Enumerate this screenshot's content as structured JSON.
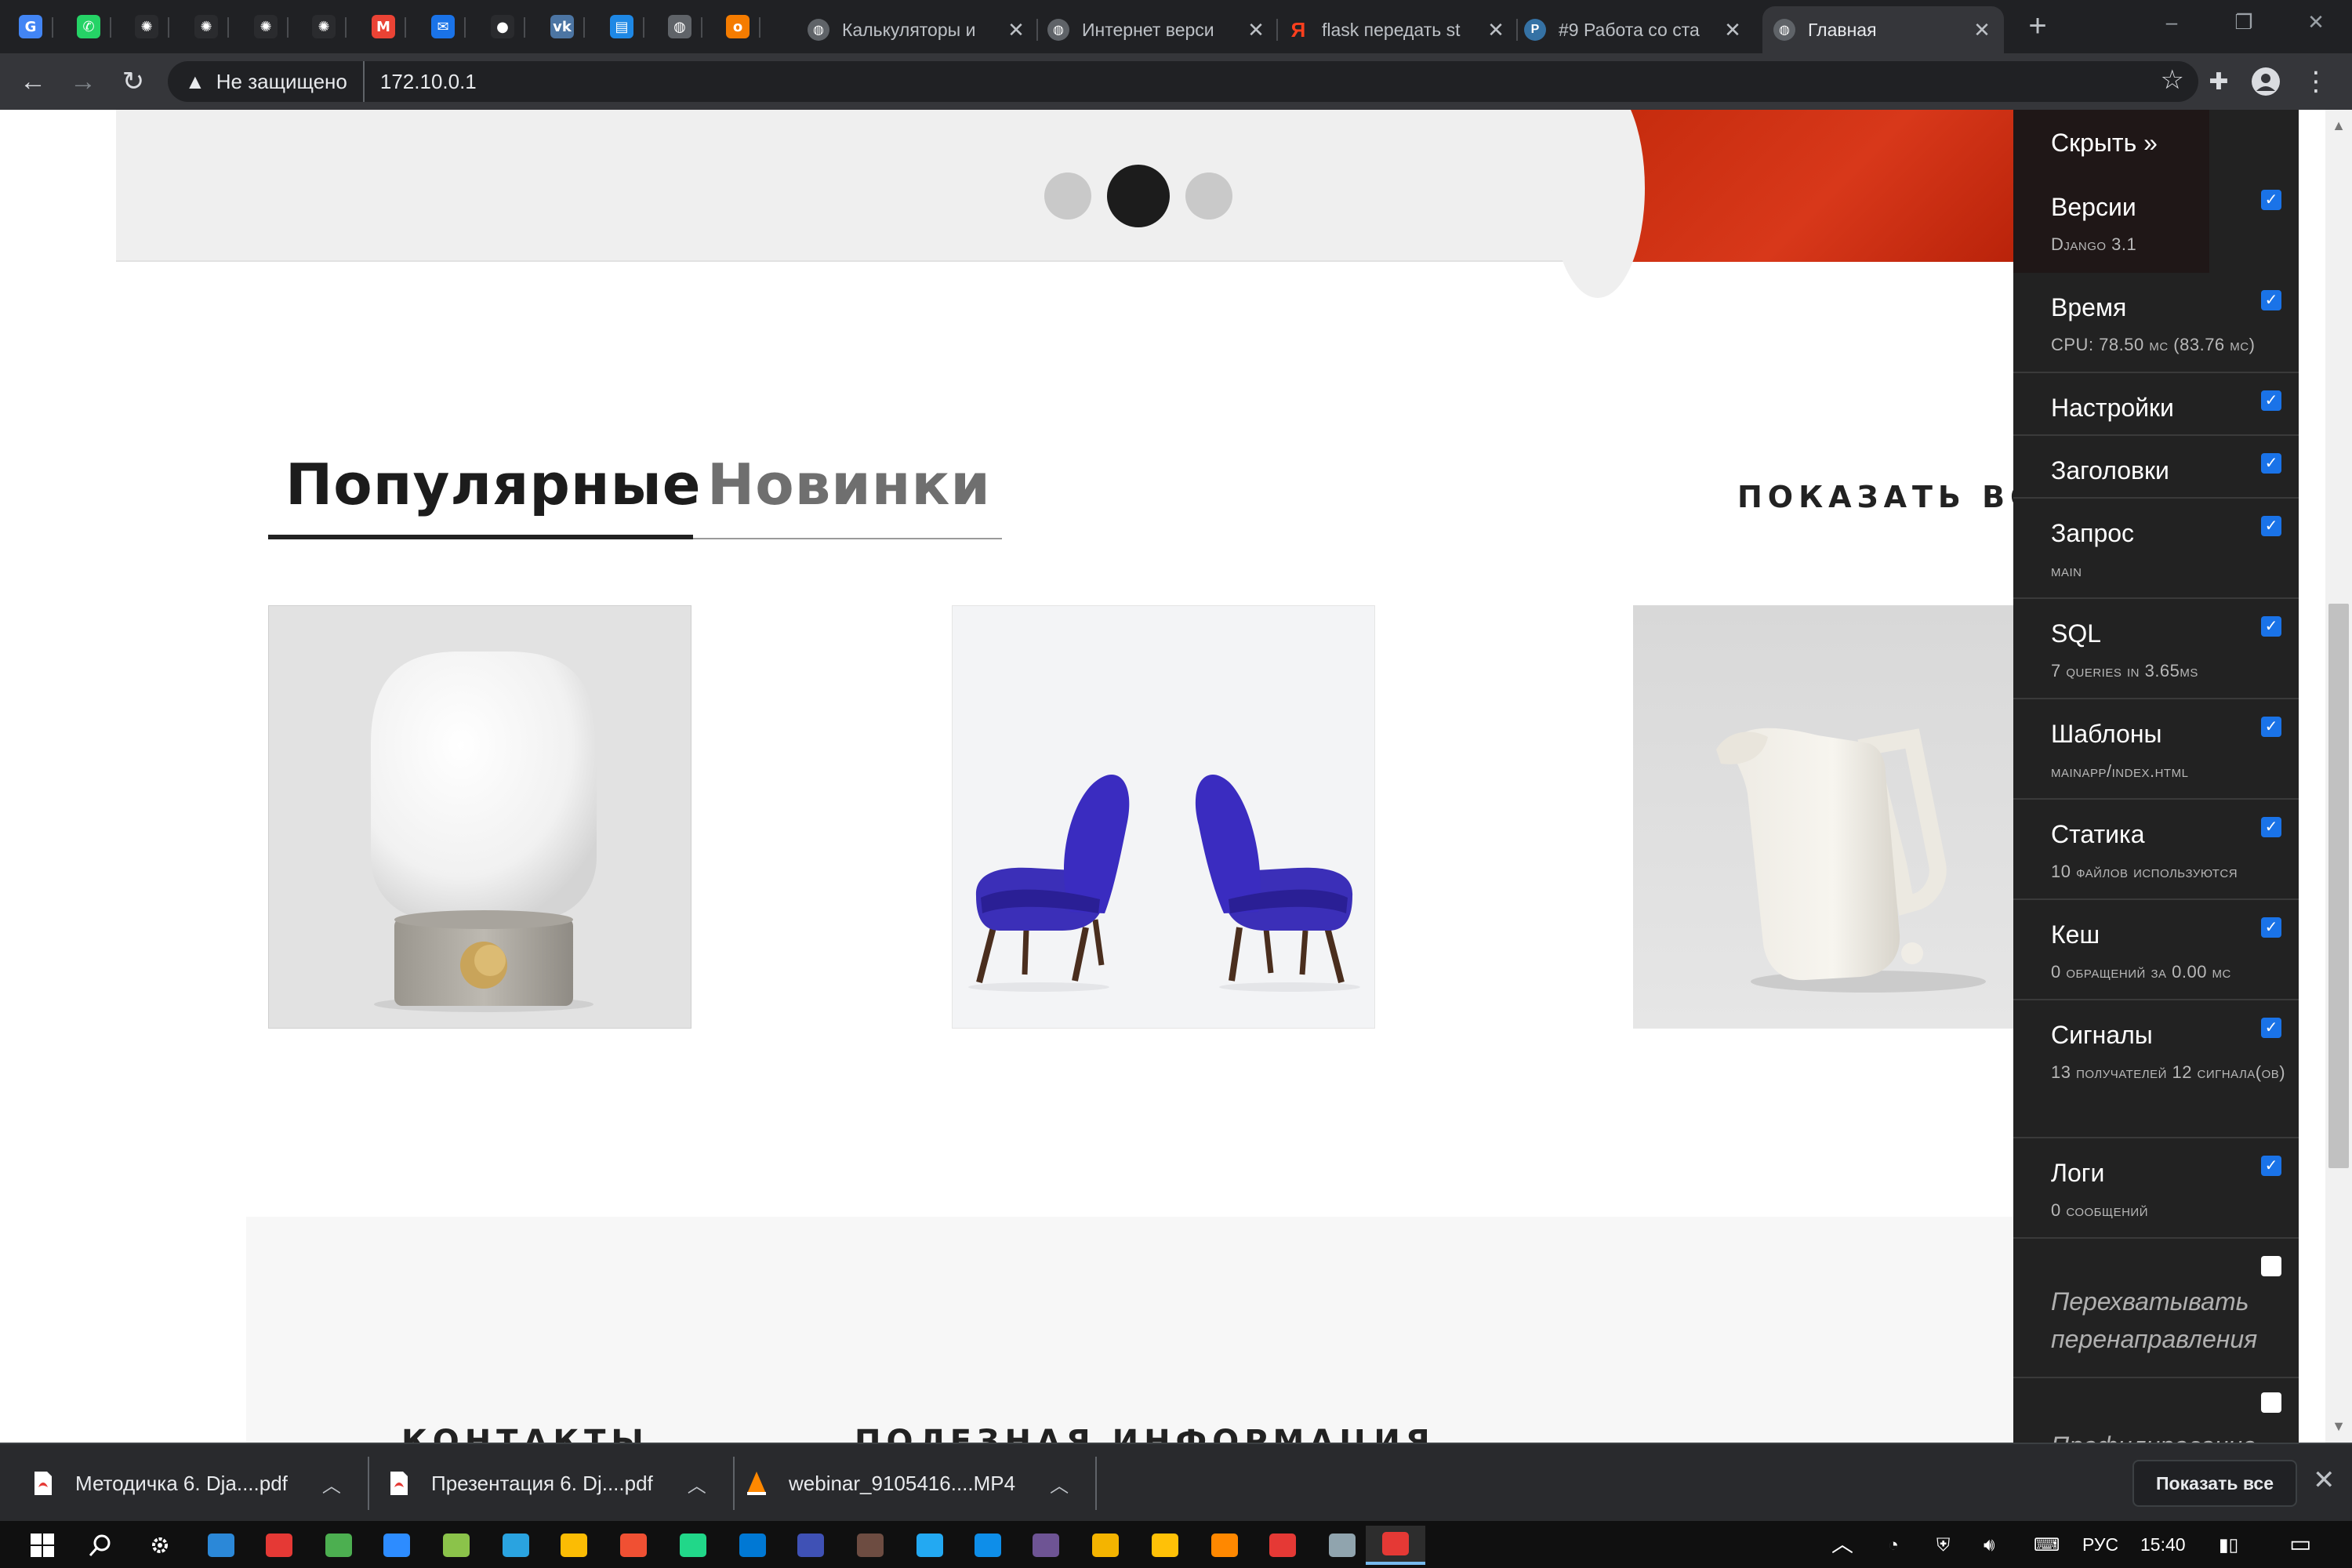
{
  "browser": {
    "pinned_tabs": [
      {
        "name": "google-translate",
        "color": "#4285f4",
        "glyph": "G"
      },
      {
        "name": "whatsapp",
        "color": "#25d366",
        "glyph": "✆"
      },
      {
        "name": "openai-1",
        "color": "#2a2b2e",
        "glyph": "✺"
      },
      {
        "name": "openai-2",
        "color": "#2a2b2e",
        "glyph": "✺"
      },
      {
        "name": "openai-3",
        "color": "#2a2b2e",
        "glyph": "✺"
      },
      {
        "name": "openai-4",
        "color": "#2a2b2e",
        "glyph": "✺"
      },
      {
        "name": "gmail",
        "color": "#ea4335",
        "glyph": "M"
      },
      {
        "name": "mail",
        "color": "#1a73e8",
        "glyph": "✉"
      },
      {
        "name": "github",
        "color": "#2a2b2e",
        "glyph": "●"
      },
      {
        "name": "vk",
        "color": "#4c75a3",
        "glyph": "vk"
      },
      {
        "name": "translate-app",
        "color": "#1e88e5",
        "glyph": "▤"
      },
      {
        "name": "globe",
        "color": "#5f6368",
        "glyph": "◍"
      },
      {
        "name": "ok",
        "color": "#f57c00",
        "glyph": "o"
      }
    ],
    "tabs": [
      {
        "title": "Калькуляторы и",
        "favicon": "globe-icon"
      },
      {
        "title": "Интернет верси",
        "favicon": "globe-icon"
      },
      {
        "title": "flask передать st",
        "favicon": "yandex-icon"
      },
      {
        "title": "#9 Работа со ста",
        "favicon": "python-icon"
      },
      {
        "title": "Главная",
        "favicon": "globe-icon"
      }
    ],
    "new_tab": "+",
    "security_label": "Не защищено",
    "url": "172.10.0.1"
  },
  "page": {
    "tabs": [
      {
        "label": "Популярные",
        "active": true
      },
      {
        "label": "Новинки",
        "active": false
      }
    ],
    "show_all": "ПОКАЗАТЬ ВСЕ",
    "show_all_arrow": "›",
    "carousel_dots": 3,
    "carousel_active_index": 1,
    "products": [
      {
        "name": "lamp-image"
      },
      {
        "name": "chairs-image"
      },
      {
        "name": "jug-image"
      }
    ],
    "footer_headings": [
      "КОНТАКТЫ",
      "ПОЛЕЗНАЯ ИНФОРМАЦИЯ"
    ]
  },
  "debug_toolbar": {
    "hide": "Скрыть »",
    "panels": [
      {
        "title": "Версии",
        "sub": "Django 3.1",
        "checked": true
      },
      {
        "title": "Время",
        "sub": "CPU: 78.50 мс (83.76 мс)",
        "checked": true
      },
      {
        "title": "Настройки",
        "sub": "",
        "checked": true
      },
      {
        "title": "Заголовки",
        "sub": "",
        "checked": true
      },
      {
        "title": "Запрос",
        "sub": "main",
        "checked": true
      },
      {
        "title": "SQL",
        "sub": "7 queries in 3.65ms",
        "checked": true
      },
      {
        "title": "Шаблоны",
        "sub": "mainapp/index.html",
        "checked": true
      },
      {
        "title": "Статика",
        "sub": "10 файлов используются",
        "checked": true
      },
      {
        "title": "Кеш",
        "sub": "0 обращений за 0.00 мс",
        "checked": true
      },
      {
        "title": "Сигналы",
        "sub": "13 получателей 12 сигнала(ов)",
        "checked": true
      },
      {
        "title": "Логи",
        "sub": "0 сообщений",
        "checked": true
      }
    ],
    "intercept_redirects": "Перехватывать перенаправления",
    "profiling": "Профилирование"
  },
  "downloads": [
    {
      "name": "Методичка 6. Dja....pdf",
      "type": "pdf-icon"
    },
    {
      "name": "Презентация 6. Dj....pdf",
      "type": "pdf-icon"
    },
    {
      "name": "webinar_9105416....MP4",
      "type": "vlc-icon"
    }
  ],
  "downloads_show_all": "Показать все",
  "taskbar": {
    "language": "РУС",
    "time": "15:40"
  }
}
